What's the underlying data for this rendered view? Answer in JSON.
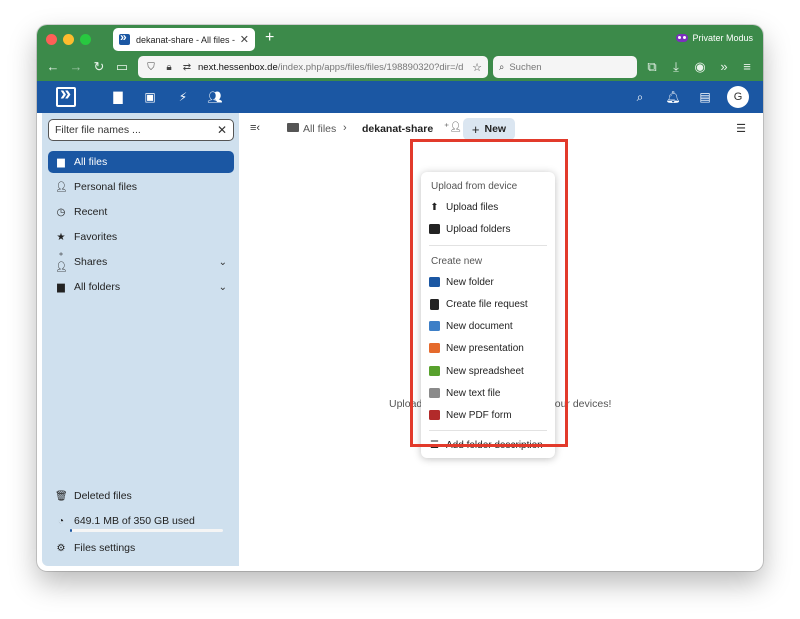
{
  "browser": {
    "tab_title": "dekanat-share - All files - Files",
    "tab_close": "✕",
    "new_tab": "+",
    "private_label": "Privater Modus",
    "url_host": "next.hessenbox.de",
    "url_path": "/index.php/apps/files/files/198890320?dir=/d",
    "search_placeholder": "Suchen"
  },
  "header": {
    "avatar_initial": "G"
  },
  "sidebar": {
    "filter_placeholder": "Filter file names ...",
    "items": [
      {
        "label": "All files"
      },
      {
        "label": "Personal files"
      },
      {
        "label": "Recent"
      },
      {
        "label": "Favorites"
      },
      {
        "label": "Shares"
      },
      {
        "label": "All folders"
      }
    ],
    "deleted": "Deleted files",
    "quota": "649.1 MB of 350 GB used",
    "quota_fraction": 0.0019,
    "settings": "Files settings"
  },
  "breadcrumb": {
    "root": "All files",
    "current": "dekanat-share",
    "new_label": "New"
  },
  "empty": {
    "message": "Upload some content or sync with your devices!"
  },
  "menu": {
    "heading_upload": "Upload from device",
    "upload_files": "Upload files",
    "upload_folders": "Upload folders",
    "heading_create": "Create new",
    "new_folder": "New folder",
    "file_request": "Create file request",
    "new_document": "New document",
    "new_presentation": "New presentation",
    "new_spreadsheet": "New spreadsheet",
    "new_text": "New text file",
    "new_pdf": "New PDF form",
    "add_description": "Add folder description"
  },
  "colors": {
    "browser_green": "#3c8a4a",
    "brand_blue": "#1b57a3",
    "sidebar_bg": "#cfe0ee",
    "highlight_red": "#e23a2b",
    "doc_blue": "#3d7fc7",
    "pres_orange": "#e56a2c",
    "sheet_green": "#58a12d",
    "text_gray": "#8a8a8a",
    "pdf_red": "#b22a2a"
  }
}
